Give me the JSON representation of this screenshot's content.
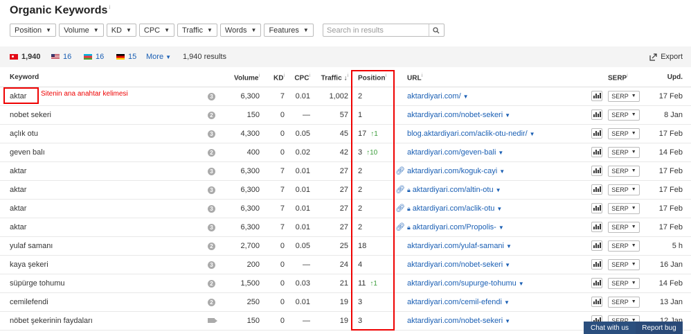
{
  "title": "Organic Keywords",
  "title_info": "i",
  "filters": [
    "Position",
    "Volume",
    "KD",
    "CPC",
    "Traffic",
    "Words",
    "Features"
  ],
  "search": {
    "placeholder": "Search in results"
  },
  "summary": {
    "countries": [
      {
        "flag": "turkey-flag",
        "count": "1,940"
      },
      {
        "flag": "us-flag",
        "count": "16"
      },
      {
        "flag": "azerbaijan-flag",
        "count": "16"
      },
      {
        "flag": "germany-flag",
        "count": "15"
      }
    ],
    "more_label": "More",
    "results": "1,940 results",
    "export_label": "Export"
  },
  "columns": {
    "keyword": "Keyword",
    "volume": "Volume",
    "kd": "KD",
    "cpc": "CPC",
    "traffic": "Traffic",
    "position": "Position",
    "url": "URL",
    "serp": "SERP",
    "upd": "Upd."
  },
  "rows": [
    {
      "keyword": "aktar",
      "icon": "3",
      "volume": "6,300",
      "kd": "7",
      "cpc": "0.01",
      "traffic": "1,002",
      "position": "2",
      "change": "",
      "link": false,
      "lock": false,
      "url": "aktardiyari.com/",
      "upd": "17 Feb"
    },
    {
      "keyword": "nobet sekeri",
      "icon": "2",
      "volume": "150",
      "kd": "0",
      "cpc": "—",
      "traffic": "57",
      "position": "1",
      "change": "",
      "link": false,
      "lock": false,
      "url": "aktardiyari.com/nobet-sekeri",
      "upd": "8 Jan"
    },
    {
      "keyword": "açlık otu",
      "icon": "3",
      "volume": "4,300",
      "kd": "0",
      "cpc": "0.05",
      "traffic": "45",
      "position": "17",
      "change": "↑1",
      "link": false,
      "lock": false,
      "url": "blog.aktardiyari.com/aclik-otu-nedir/",
      "upd": "17 Feb"
    },
    {
      "keyword": "geven balı",
      "icon": "2",
      "volume": "400",
      "kd": "0",
      "cpc": "0.02",
      "traffic": "42",
      "position": "3",
      "change": "↑10",
      "link": false,
      "lock": false,
      "url": "aktardiyari.com/geven-bali",
      "upd": "14 Feb"
    },
    {
      "keyword": "aktar",
      "icon": "3",
      "volume": "6,300",
      "kd": "7",
      "cpc": "0.01",
      "traffic": "27",
      "position": "2",
      "change": "",
      "link": true,
      "lock": false,
      "url": "aktardiyari.com/koguk-cayi",
      "upd": "17 Feb"
    },
    {
      "keyword": "aktar",
      "icon": "3",
      "volume": "6,300",
      "kd": "7",
      "cpc": "0.01",
      "traffic": "27",
      "position": "2",
      "change": "",
      "link": true,
      "lock": true,
      "url": "aktardiyari.com/altin-otu",
      "upd": "17 Feb"
    },
    {
      "keyword": "aktar",
      "icon": "3",
      "volume": "6,300",
      "kd": "7",
      "cpc": "0.01",
      "traffic": "27",
      "position": "2",
      "change": "",
      "link": true,
      "lock": true,
      "url": "aktardiyari.com/aclik-otu",
      "upd": "17 Feb"
    },
    {
      "keyword": "aktar",
      "icon": "3",
      "volume": "6,300",
      "kd": "7",
      "cpc": "0.01",
      "traffic": "27",
      "position": "2",
      "change": "",
      "link": true,
      "lock": true,
      "url": "aktardiyari.com/Propolis-",
      "upd": "17 Feb"
    },
    {
      "keyword": "yulaf samanı",
      "icon": "2",
      "volume": "2,700",
      "kd": "0",
      "cpc": "0.05",
      "traffic": "25",
      "position": "18",
      "change": "",
      "link": false,
      "lock": false,
      "url": "aktardiyari.com/yulaf-samani",
      "upd": "5 h"
    },
    {
      "keyword": "kaya şekeri",
      "icon": "3",
      "volume": "200",
      "kd": "0",
      "cpc": "—",
      "traffic": "24",
      "position": "4",
      "change": "",
      "link": false,
      "lock": false,
      "url": "aktardiyari.com/nobet-sekeri",
      "upd": "16 Jan"
    },
    {
      "keyword": "süpürge tohumu",
      "icon": "2",
      "volume": "1,500",
      "kd": "0",
      "cpc": "0.03",
      "traffic": "21",
      "position": "11",
      "change": "↑1",
      "link": false,
      "lock": false,
      "url": "aktardiyari.com/supurge-tohumu",
      "upd": "14 Feb"
    },
    {
      "keyword": "cemilefendi",
      "icon": "2",
      "volume": "250",
      "kd": "0",
      "cpc": "0.01",
      "traffic": "19",
      "position": "3",
      "change": "",
      "link": false,
      "lock": false,
      "url": "aktardiyari.com/cemil-efendi",
      "upd": "13 Jan"
    },
    {
      "keyword": "nöbet şekerinin faydaları",
      "icon": "video",
      "volume": "150",
      "kd": "0",
      "cpc": "—",
      "traffic": "19",
      "position": "3",
      "change": "",
      "link": false,
      "lock": false,
      "url": "aktardiyari.com/nobet-sekeri",
      "upd": "12 Jan"
    }
  ],
  "serp_button": "SERP",
  "annotation": "Sitenin ana anahtar kelimesi",
  "bottom": {
    "chat": "Chat with us",
    "report": "Report bug"
  },
  "colors": {
    "link": "#1a5fb4",
    "annotation": "#e00000",
    "bottom_bar": "#2b4f7e",
    "positive": "#3b9d3b"
  }
}
